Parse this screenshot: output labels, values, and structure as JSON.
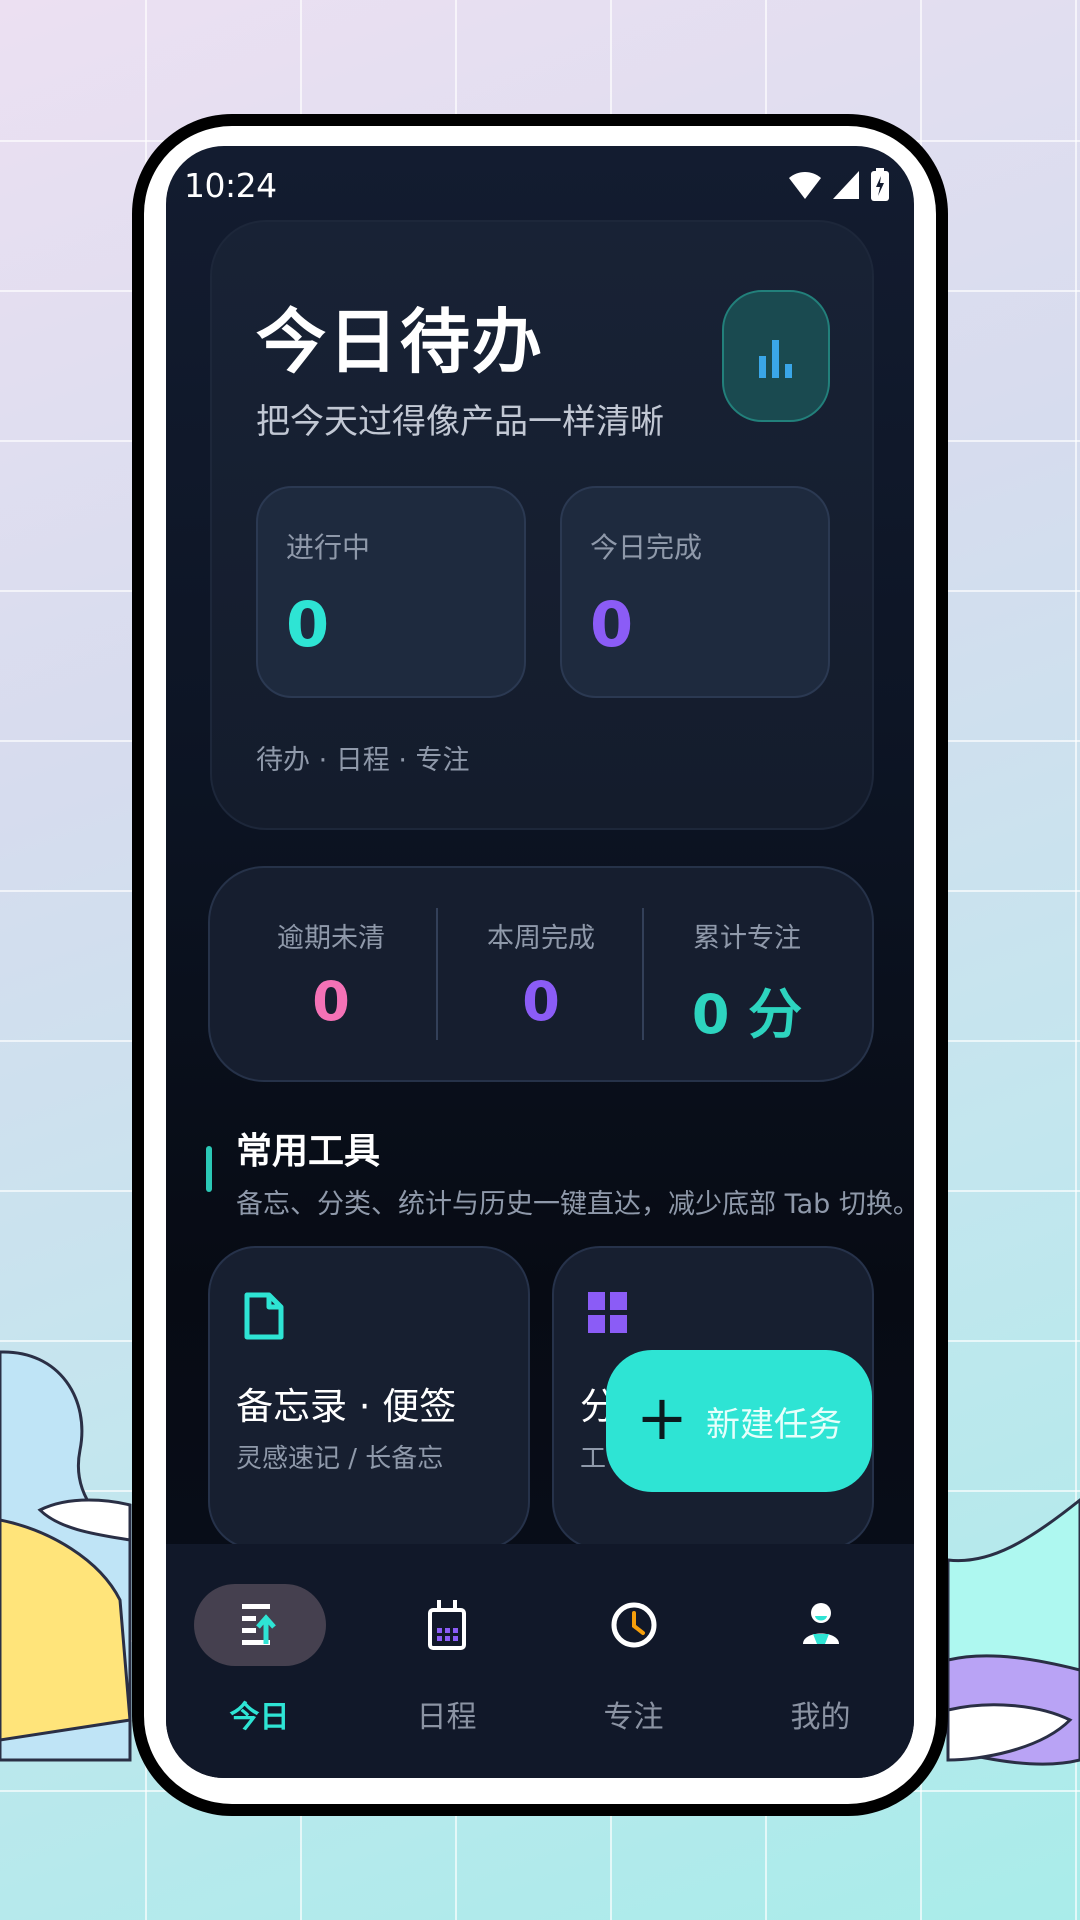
{
  "status_bar": {
    "time": "10:24"
  },
  "hero": {
    "title": "今日待办",
    "subtitle": "把今天过得像产品一样清晰",
    "in_progress": {
      "label": "进行中",
      "value": "0"
    },
    "done_today": {
      "label": "今日完成",
      "value": "0"
    },
    "footer": "待办 · 日程 · 专注"
  },
  "summary": {
    "overdue": {
      "label": "逾期未清",
      "value": "0"
    },
    "week_done": {
      "label": "本周完成",
      "value": "0"
    },
    "focus_total": {
      "label": "累计专注",
      "value": "0 分"
    }
  },
  "tools_section": {
    "title": "常用工具",
    "subtitle": "备忘、分类、统计与历史一键直达，减少底部 Tab 切换。",
    "cards": [
      {
        "title": "备忘录 · 便签",
        "subtitle": "灵感速记 / 长备忘",
        "icon": "note-icon"
      },
      {
        "title": "分",
        "subtitle": "工",
        "icon": "grid-icon"
      }
    ]
  },
  "fab": {
    "label": "新建任务"
  },
  "nav": {
    "items": [
      {
        "label": "今日",
        "icon": "today-icon",
        "active": true
      },
      {
        "label": "日程",
        "icon": "calendar-icon",
        "active": false
      },
      {
        "label": "专注",
        "icon": "clock-icon",
        "active": false
      },
      {
        "label": "我的",
        "icon": "profile-icon",
        "active": false
      }
    ]
  },
  "colors": {
    "accent_teal": "#2ee4d4",
    "accent_purple": "#8b5cf6",
    "accent_pink": "#f472b6",
    "focus_cyan": "#2dd4bf"
  }
}
